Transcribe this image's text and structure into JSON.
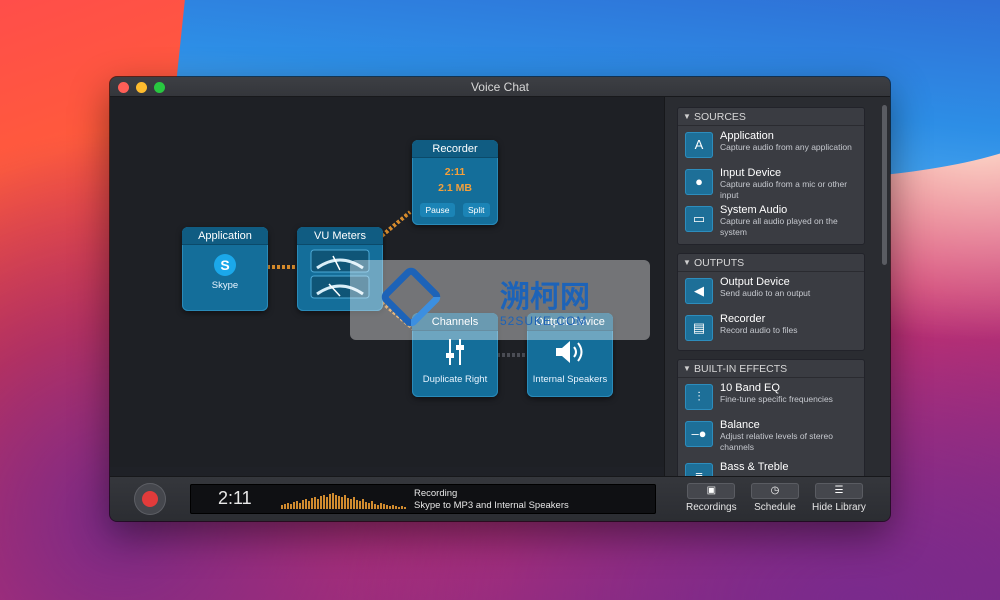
{
  "window": {
    "title": "Voice Chat"
  },
  "nodes": {
    "application": {
      "title": "Application",
      "label": "Skype"
    },
    "vu": {
      "title": "VU Meters"
    },
    "recorder": {
      "title": "Recorder",
      "time": "2:11",
      "size": "2.1 MB",
      "pause": "Pause",
      "split": "Split"
    },
    "channels": {
      "title": "Channels",
      "label": "Duplicate Right"
    },
    "output": {
      "title": "Output Device",
      "label": "Internal Speakers"
    }
  },
  "sidebar": {
    "sources": {
      "header": "SOURCES",
      "items": [
        {
          "title": "Application",
          "desc": "Capture audio from any application",
          "icon": "app-store-icon"
        },
        {
          "title": "Input Device",
          "desc": "Capture audio from a mic or other input",
          "icon": "microphone-icon"
        },
        {
          "title": "System Audio",
          "desc": "Capture all audio played on the system",
          "icon": "monitor-icon"
        }
      ]
    },
    "outputs": {
      "header": "OUTPUTS",
      "items": [
        {
          "title": "Output Device",
          "desc": "Send audio to an output",
          "icon": "speaker-icon"
        },
        {
          "title": "Recorder",
          "desc": "Record audio to files",
          "icon": "document-icon"
        }
      ]
    },
    "effects": {
      "header": "BUILT-IN EFFECTS",
      "items": [
        {
          "title": "10 Band EQ",
          "desc": "Fine-tune specific frequencies",
          "icon": "equalizer-icon"
        },
        {
          "title": "Balance",
          "desc": "Adjust relative levels of stereo channels",
          "icon": "balance-icon"
        },
        {
          "title": "Bass & Treble",
          "desc": "",
          "icon": "bass-treble-icon"
        }
      ]
    }
  },
  "bottombar": {
    "time": "2:11",
    "status_title": "Recording",
    "status_detail": "Skype to MP3 and Internal Speakers",
    "recordings": "Recordings",
    "schedule": "Schedule",
    "hide_library": "Hide Library"
  },
  "watermark": {
    "text": "溯柯网",
    "sub": "52SUKE.COM"
  },
  "colors": {
    "accent": "#146e9a",
    "level": "#d08b2f",
    "record": "#e23b3b"
  }
}
